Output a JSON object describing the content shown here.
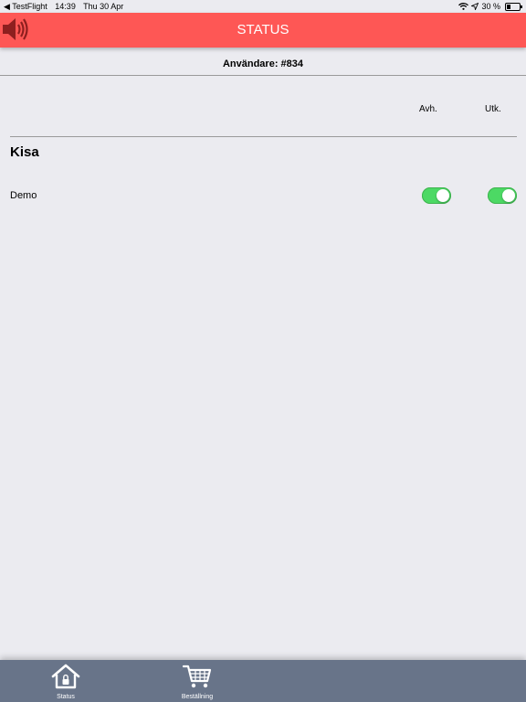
{
  "statusbar": {
    "back_app": "◀ TestFlight",
    "time": "14:39",
    "date": "Thu 30 Apr",
    "battery": "30 %",
    "battery_level": 0.3
  },
  "header": {
    "title": "STATUS",
    "speaker_icon": "speaker-icon",
    "color": "#fe5755"
  },
  "user": {
    "label": "Användare: #834"
  },
  "columns": {
    "avh": "Avh.",
    "utk": "Utk."
  },
  "group": {
    "title": "Kisa",
    "rows": [
      {
        "label": "Demo",
        "avh_on": true,
        "utk_on": true
      }
    ]
  },
  "tabbar": {
    "color": "#687489",
    "tabs": [
      {
        "label": "Status",
        "icon": "home-icon"
      },
      {
        "label": "Beställning",
        "icon": "cart-icon"
      }
    ]
  },
  "toggle_color": "#4cd964"
}
